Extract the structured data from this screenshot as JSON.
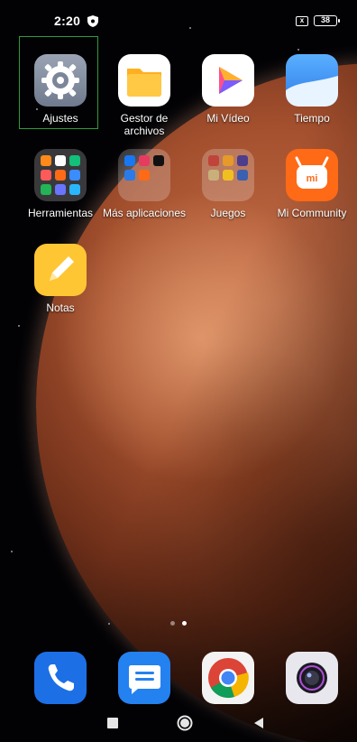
{
  "status": {
    "time": "2:20",
    "battery": "38",
    "sim_status": "x"
  },
  "apps": [
    {
      "label": "Ajustes"
    },
    {
      "label": "Gestor de archivos"
    },
    {
      "label": "Mi Vídeo"
    },
    {
      "label": "Tiempo"
    },
    {
      "label": "Herramientas"
    },
    {
      "label": "Más aplicaciones"
    },
    {
      "label": "Juegos"
    },
    {
      "label": "Mi Community"
    },
    {
      "label": "Notas"
    }
  ],
  "mi_logo": "mi",
  "dock": [
    {
      "name": "phone-icon"
    },
    {
      "name": "messages-icon"
    },
    {
      "name": "chrome-icon"
    },
    {
      "name": "camera-icon"
    }
  ],
  "page_indicator": {
    "pages": 2,
    "current": 2
  },
  "colors": {
    "selection_border": "#2e9a3c",
    "planet": "#a4502e"
  }
}
